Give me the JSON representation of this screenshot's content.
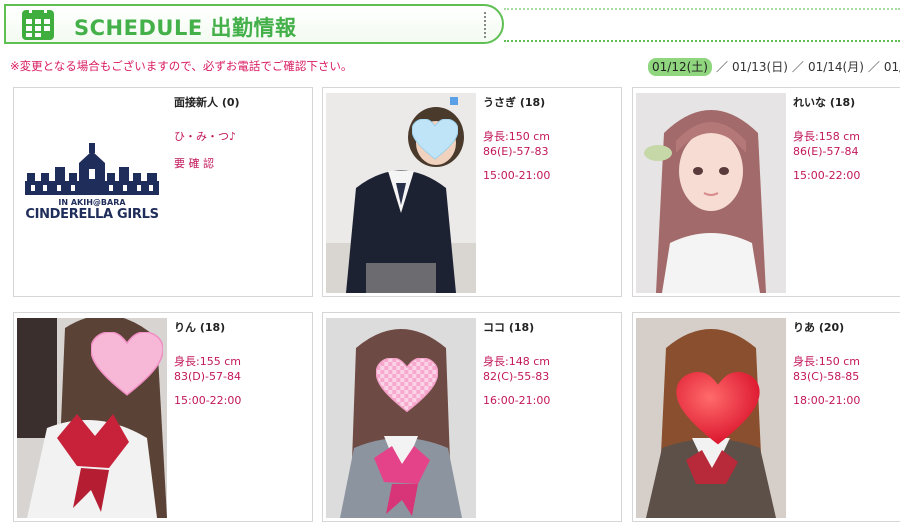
{
  "header": {
    "title": "SCHEDULE 出勤情報"
  },
  "notice": "※変更となる場合もございますので、必ずお電話でご確認下さい。",
  "dates": {
    "active": "01/12(土)",
    "links": [
      "01/13(日)",
      "01/14(月)",
      "01/"
    ]
  },
  "logo": {
    "line1": "IN AKIH@BARA",
    "line2": "CINDERELLA GIRLS"
  },
  "cards": [
    {
      "name": "面接新人 (0)",
      "l1": "ひ・み・つ♪",
      "l2": "",
      "l3": "要 確 認"
    },
    {
      "name": "うさぎ (18)",
      "l1": "身長:150 cm",
      "l2": "86(E)-57-83",
      "l3": "15:00-21:00"
    },
    {
      "name": "れいな (18)",
      "l1": "身長:158 cm",
      "l2": "86(E)-57-84",
      "l3": "15:00-22:00"
    },
    {
      "name": "りん (18)",
      "l1": "身長:155 cm",
      "l2": "83(D)-57-84",
      "l3": "15:00-22:00"
    },
    {
      "name": "ココ (18)",
      "l1": "身長:148 cm",
      "l2": "82(C)-55-83",
      "l3": "16:00-21:00"
    },
    {
      "name": "りあ (20)",
      "l1": "身長:150 cm",
      "l2": "83(C)-58-85",
      "l3": "18:00-21:00"
    }
  ],
  "colors": {
    "accent": "#44b04a",
    "pink": "#c2185b"
  }
}
